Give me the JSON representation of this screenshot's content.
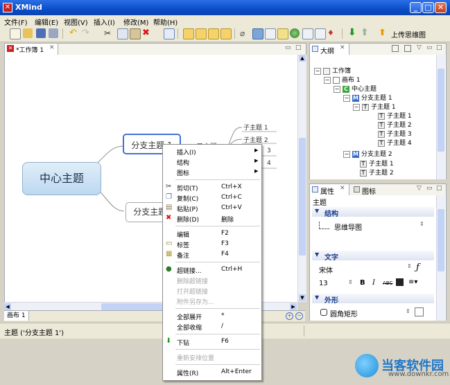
{
  "window": {
    "title": "XMind"
  },
  "menu": [
    "文件(F)",
    "编辑(E)",
    "视图(V)",
    "插入(I)",
    "修改(M)",
    "帮助(H)"
  ],
  "toolbar": {
    "upload_label": "上传思维图"
  },
  "editor": {
    "tab_label": "*工作簿 1",
    "sheet_tab": "画布 1"
  },
  "mindmap": {
    "central": "中心主题",
    "branch1": "分支主题 1",
    "branch2": "分支主题 2",
    "sub_topics": [
      "子主题 1",
      "子主题 2",
      "3",
      "4"
    ],
    "partial_label": "子主题 1"
  },
  "status": {
    "text": "主题 ('分支主题 1')"
  },
  "outline": {
    "title": "大纲",
    "items": [
      {
        "label": "工作簿",
        "icon": "workbook-icon"
      },
      {
        "label": "画布 1",
        "icon": "sheet-icon"
      },
      {
        "label": "中心主题",
        "icon": "central-topic-icon"
      },
      {
        "label": "分支主题 1",
        "icon": "main-topic-icon"
      },
      {
        "label": "子主题 1",
        "icon": "topic-icon"
      },
      {
        "label": "子主题 1",
        "icon": "topic-icon"
      },
      {
        "label": "子主题 2",
        "icon": "topic-icon"
      },
      {
        "label": "子主题 3",
        "icon": "topic-icon"
      },
      {
        "label": "子主题 4",
        "icon": "topic-icon"
      },
      {
        "label": "分支主题 2",
        "icon": "main-topic-icon"
      },
      {
        "label": "子主题 1",
        "icon": "topic-icon"
      },
      {
        "label": "子主题 2",
        "icon": "topic-icon"
      }
    ]
  },
  "properties": {
    "tab1": "属性",
    "tab2": "图标",
    "heading": "主题",
    "structure_section": "结构",
    "structure_value": "思维导图",
    "text_section": "文字",
    "font_name": "宋体",
    "font_size": "13",
    "bold": "B",
    "italic": "I",
    "strike": "ABC",
    "appearance_section": "外形",
    "shape_value": "圆角矩形"
  },
  "context_menu": [
    {
      "label": "插入(I)",
      "shortcut": "",
      "arrow": true,
      "disabled": false
    },
    {
      "label": "结构",
      "shortcut": "",
      "arrow": true,
      "disabled": false
    },
    {
      "label": "图标",
      "shortcut": "",
      "arrow": true,
      "disabled": false
    },
    {
      "sep": true
    },
    {
      "label": "剪切(T)",
      "shortcut": "Ctrl+X",
      "icon": "scissors-icon",
      "disabled": false
    },
    {
      "label": "复制(C)",
      "shortcut": "Ctrl+C",
      "icon": "copy-icon",
      "disabled": false
    },
    {
      "label": "粘贴(P)",
      "shortcut": "Ctrl+V",
      "icon": "paste-icon",
      "disabled": false
    },
    {
      "label": "删除(D)",
      "shortcut": "删除",
      "icon": "delete-icon",
      "disabled": false
    },
    {
      "sep": true
    },
    {
      "label": "编辑",
      "shortcut": "F2",
      "disabled": false
    },
    {
      "label": "标签",
      "shortcut": "F3",
      "icon": "label-icon",
      "disabled": false
    },
    {
      "label": "备注",
      "shortcut": "F4",
      "icon": "notes-icon",
      "disabled": false
    },
    {
      "sep": true
    },
    {
      "label": "超链接...",
      "shortcut": "Ctrl+H",
      "icon": "hyperlink-icon",
      "disabled": false
    },
    {
      "label": "删除超链接",
      "shortcut": "",
      "disabled": true
    },
    {
      "label": "打开超链接",
      "shortcut": "",
      "disabled": true
    },
    {
      "label": "附件另存为...",
      "shortcut": "",
      "disabled": true
    },
    {
      "sep": true
    },
    {
      "label": "全部展开",
      "shortcut": "*",
      "disabled": false
    },
    {
      "label": "全部收缩",
      "shortcut": "/",
      "disabled": false
    },
    {
      "sep": true
    },
    {
      "label": "下钻",
      "shortcut": "F6",
      "icon": "drill-down-icon",
      "disabled": false
    },
    {
      "sep": true
    },
    {
      "label": "重新安排位置",
      "shortcut": "",
      "disabled": true
    },
    {
      "sep": true
    },
    {
      "label": "属性(R)",
      "shortcut": "Alt+Enter",
      "disabled": false
    }
  ],
  "watermark": {
    "text": "当客软件园",
    "url": "www.downkr.com"
  },
  "colors": {
    "titlebar": "#0a4ec8",
    "central_topic": "#c9e2f5",
    "menu_bg": "#ece9d8",
    "section_text": "#1d3f8a"
  }
}
